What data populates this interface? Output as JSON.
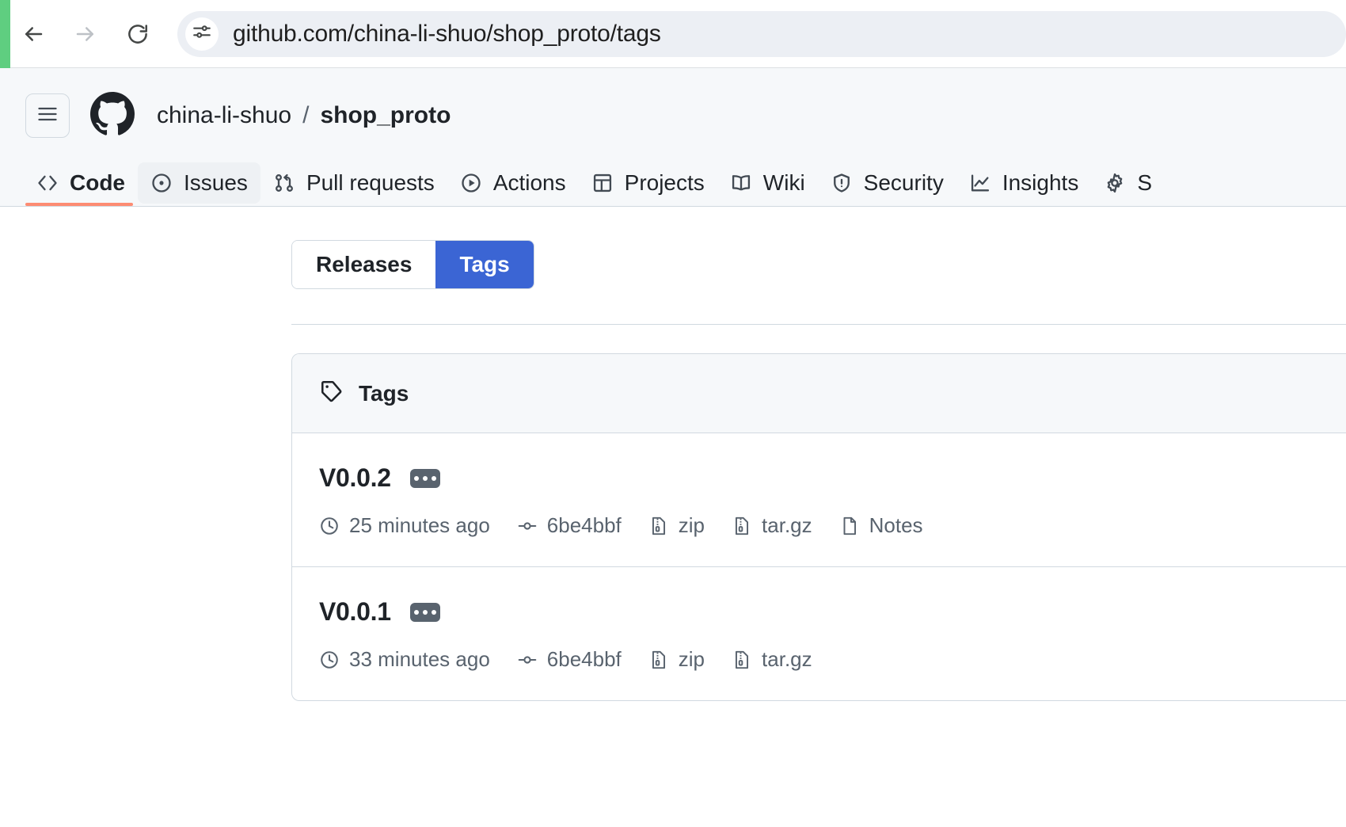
{
  "browser": {
    "back_icon": "arrow-left-icon",
    "forward_icon": "arrow-right-icon",
    "reload_icon": "reload-icon",
    "site_info_icon": "site-settings-icon",
    "url": "github.com/china-li-shuo/shop_proto/tags",
    "accent_strip_color": "#5fce80"
  },
  "header": {
    "hamburger_icon": "hamburger-menu-icon",
    "logo_icon": "github-mark-icon",
    "owner": "china-li-shuo",
    "separator": "/",
    "repo": "shop_proto"
  },
  "nav": {
    "active_underline_color": "#fd8c73",
    "tabs": [
      {
        "label": "Code",
        "icon": "code-icon",
        "state": "selected"
      },
      {
        "label": "Issues",
        "icon": "issue-opened-icon",
        "state": "hovered"
      },
      {
        "label": "Pull requests",
        "icon": "git-pull-request-icon",
        "state": "normal"
      },
      {
        "label": "Actions",
        "icon": "play-icon",
        "state": "normal"
      },
      {
        "label": "Projects",
        "icon": "table-icon",
        "state": "normal"
      },
      {
        "label": "Wiki",
        "icon": "book-icon",
        "state": "normal"
      },
      {
        "label": "Security",
        "icon": "shield-icon",
        "state": "normal"
      },
      {
        "label": "Insights",
        "icon": "graph-icon",
        "state": "normal"
      },
      {
        "label": "S",
        "icon": "gear-icon",
        "state": "normal"
      }
    ]
  },
  "main": {
    "toggle": {
      "releases_label": "Releases",
      "tags_label": "Tags",
      "active": "Tags",
      "active_color": "#3b65d4"
    },
    "tags_panel": {
      "header_icon": "tag-icon",
      "header_label": "Tags",
      "rows": [
        {
          "name": "V0.0.2",
          "kebab_icon": "kebab-horizontal-icon",
          "meta": [
            {
              "icon": "clock-icon",
              "label": "25 minutes ago"
            },
            {
              "icon": "commit-icon",
              "label": "6be4bbf"
            },
            {
              "icon": "file-zip-icon",
              "label": "zip"
            },
            {
              "icon": "file-zip-icon",
              "label": "tar.gz"
            },
            {
              "icon": "file-icon",
              "label": "Notes"
            }
          ]
        },
        {
          "name": "V0.0.1",
          "kebab_icon": "kebab-horizontal-icon",
          "meta": [
            {
              "icon": "clock-icon",
              "label": "33 minutes ago"
            },
            {
              "icon": "commit-icon",
              "label": "6be4bbf"
            },
            {
              "icon": "file-zip-icon",
              "label": "zip"
            },
            {
              "icon": "file-zip-icon",
              "label": "tar.gz"
            }
          ]
        }
      ]
    }
  }
}
